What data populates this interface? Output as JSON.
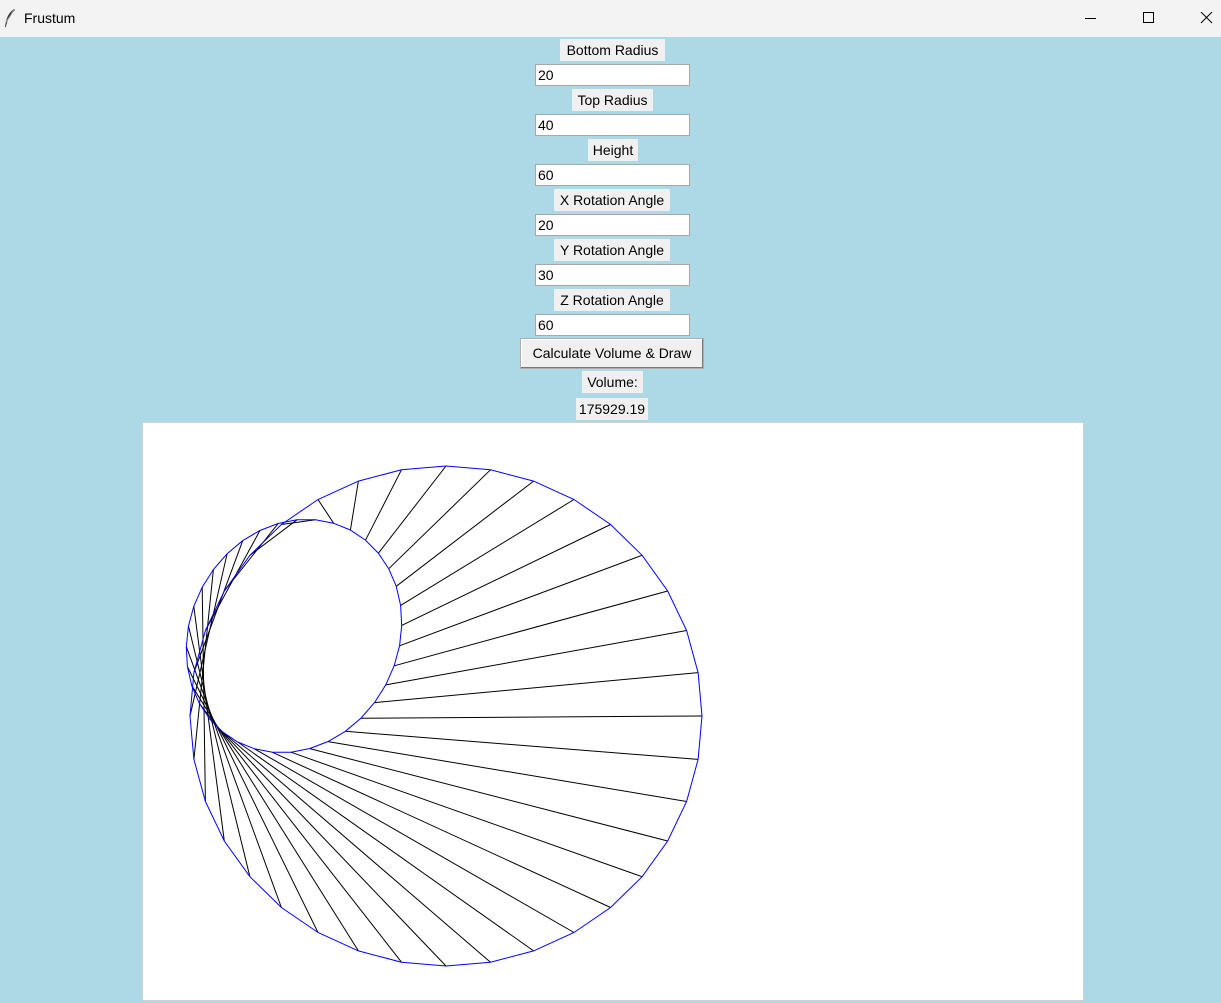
{
  "window": {
    "title": "Frustum",
    "app_icon": "feather-icon",
    "controls": [
      "minimize-icon",
      "maximize-icon",
      "close-icon"
    ]
  },
  "form": {
    "bottom_radius": {
      "label": "Bottom Radius",
      "value": "20"
    },
    "top_radius": {
      "label": "Top Radius",
      "value": "40"
    },
    "height": {
      "label": "Height",
      "value": "60"
    },
    "x_rotation": {
      "label": "X Rotation Angle",
      "value": "20"
    },
    "y_rotation": {
      "label": "Y Rotation Angle",
      "value": "30"
    },
    "z_rotation": {
      "label": "Z Rotation Angle",
      "value": "60"
    },
    "calculate_button": "Calculate Volume & Draw"
  },
  "result": {
    "volume_label": "Volume:",
    "volume_value": "175929.19"
  },
  "drawing": {
    "edge_color": "#0000ff",
    "generator_color": "#000000",
    "background": "#ffffff",
    "segments": 36
  }
}
